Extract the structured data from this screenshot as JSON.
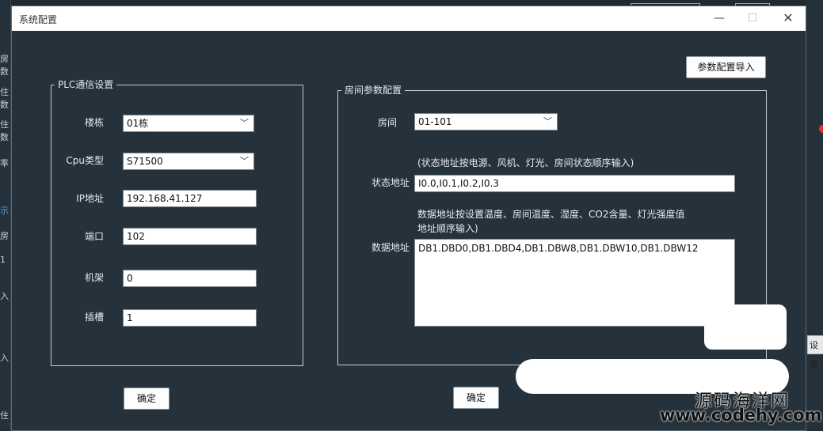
{
  "dialog": {
    "title": "系统配置",
    "min_glyph": "—",
    "max_glyph": "☐",
    "close_glyph": "✕"
  },
  "background": {
    "left_fragments": [
      "房",
      "数",
      "住",
      "数",
      "住",
      "数",
      "率",
      "示",
      "房",
      "1",
      "入",
      "入",
      "住"
    ],
    "right_button": "设置"
  },
  "import_button": "参数配置导入",
  "plc": {
    "legend": "PLC通信设置",
    "building_label": "楼栋",
    "building_value": "01栋",
    "cpu_label": "Cpu类型",
    "cpu_value": "S71500",
    "ip_label": "IP地址",
    "ip_value": "192.168.41.127",
    "port_label": "端口",
    "port_value": "102",
    "rack_label": "机架",
    "rack_value": "0",
    "slot_label": "插槽",
    "slot_value": "1",
    "ok_button": "确定"
  },
  "room": {
    "legend": "房间参数配置",
    "room_label": "房间",
    "room_value": "01-101",
    "status_hint": "(状态地址按电源、风机、灯光、房间状态顺序输入)",
    "status_label": "状态地址",
    "status_value": "I0.0,I0.1,I0.2,I0.3",
    "data_hint": "数据地址按设置温度、房间温度、湿度、CO2含量、灯光强度值\n地址顺序输入)",
    "data_label": "数据地址",
    "data_value": "DB1.DBD0,DB1.DBD4,DB1.DBW8,DB1.DBW10,DB1.DBW12",
    "ok_button": "确定"
  },
  "watermark": {
    "line1": "源码海洋网",
    "line2": "www.codehy.com"
  }
}
